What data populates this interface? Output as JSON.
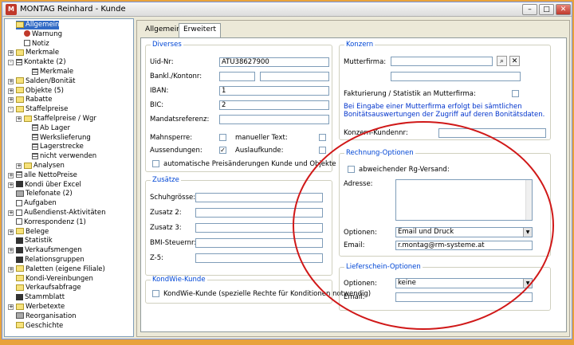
{
  "window": {
    "title": "MONTAG Reinhard - Kunde",
    "app_icon_text": "M",
    "btn_min": "–",
    "btn_max": "□",
    "btn_close": "✕"
  },
  "tree": [
    {
      "label": "Allgemein",
      "icon": "folder",
      "level": 0,
      "exp": "",
      "selected": true
    },
    {
      "label": "Warnung",
      "icon": "red",
      "level": 1,
      "exp": ""
    },
    {
      "label": "Notiz",
      "icon": "doc",
      "level": 1,
      "exp": ""
    },
    {
      "label": "Merkmale",
      "icon": "folder",
      "level": 0,
      "exp": "+"
    },
    {
      "label": "Kontakte (2)",
      "icon": "list",
      "level": 0,
      "exp": "-"
    },
    {
      "label": "Merkmale",
      "icon": "list",
      "level": 2,
      "exp": ""
    },
    {
      "label": "Salden/Bonität",
      "icon": "folder",
      "level": 0,
      "exp": "+"
    },
    {
      "label": "Objekte (5)",
      "icon": "folder",
      "level": 0,
      "exp": "+"
    },
    {
      "label": "Rabatte",
      "icon": "folder",
      "level": 0,
      "exp": "+"
    },
    {
      "label": "Staffelpreise",
      "icon": "folder",
      "level": 0,
      "exp": "-"
    },
    {
      "label": "Staffelpreise / Wgr",
      "icon": "folder",
      "level": 1,
      "exp": "+"
    },
    {
      "label": "Ab Lager",
      "icon": "list",
      "level": 2,
      "exp": ""
    },
    {
      "label": "Werkslieferung",
      "icon": "list",
      "level": 2,
      "exp": ""
    },
    {
      "label": "Lagerstrecke",
      "icon": "list",
      "level": 2,
      "exp": ""
    },
    {
      "label": "nicht verwenden",
      "icon": "list",
      "level": 2,
      "exp": ""
    },
    {
      "label": "Analysen",
      "icon": "folder",
      "level": 1,
      "exp": "+"
    },
    {
      "label": "alle NettoPreise",
      "icon": "list",
      "level": 0,
      "exp": "+"
    },
    {
      "label": "Kondi über Excel",
      "icon": "blk",
      "level": 0,
      "exp": "+"
    },
    {
      "label": "Telefonate (2)",
      "icon": "gray",
      "level": 0,
      "exp": ""
    },
    {
      "label": "Aufgaben",
      "icon": "doc",
      "level": 0,
      "exp": ""
    },
    {
      "label": "Außendienst-Aktivitäten",
      "icon": "doc",
      "level": 0,
      "exp": "+"
    },
    {
      "label": "Korrespondenz (1)",
      "icon": "doc",
      "level": 0,
      "exp": ""
    },
    {
      "label": "Belege",
      "icon": "folder",
      "level": 0,
      "exp": "+"
    },
    {
      "label": "Statistik",
      "icon": "blk",
      "level": 0,
      "exp": ""
    },
    {
      "label": "Verkaufsmengen",
      "icon": "blk",
      "level": 0,
      "exp": "+"
    },
    {
      "label": "Relationsgruppen",
      "icon": "blk",
      "level": 0,
      "exp": ""
    },
    {
      "label": "Paletten (eigene Filiale)",
      "icon": "folder",
      "level": 0,
      "exp": "+"
    },
    {
      "label": "Kondi-Vereinbungen",
      "icon": "folder",
      "level": 0,
      "exp": ""
    },
    {
      "label": "Verkaufsabfrage",
      "icon": "folder",
      "level": 0,
      "exp": ""
    },
    {
      "label": "Stammblatt",
      "icon": "blk",
      "level": 0,
      "exp": ""
    },
    {
      "label": "Werbetexte",
      "icon": "folder",
      "level": 0,
      "exp": "+"
    },
    {
      "label": "Reorganisation",
      "icon": "gray",
      "level": 0,
      "exp": ""
    },
    {
      "label": "Geschichte",
      "icon": "folder",
      "level": 0,
      "exp": ""
    }
  ],
  "tabs": {
    "allgemein": "Allgemein",
    "erweitert": "Erweitert"
  },
  "diverses": {
    "title": "Diverses",
    "uid_label": "Uid-Nr:",
    "uid_value": "ATU38627900",
    "bank_label": "Bankl./Kontonr:",
    "iban_label": "IBAN:",
    "iban_value": "1",
    "bic_label": "BIC:",
    "bic_value": "2",
    "mandat_label": "Mandatsreferenz:",
    "mahnsperre_label": "Mahnsperre:",
    "manuell_label": "manueller Text:",
    "aussendungen_label": "Aussendungen:",
    "aussendungen_check": "✓",
    "auslauf_label": "Auslaufkunde:",
    "auto_label": "automatische Preisänderungen Kunde und Objekte"
  },
  "zusaetze": {
    "title": "Zusätze",
    "schuh_label": "Schuhgrösse:",
    "z2_label": "Zusatz 2:",
    "z3_label": "Zusatz 3:",
    "bmi_label": "BMI-Steuernr:",
    "z5_label": "Z-5:"
  },
  "kondwie": {
    "title": "KondWie-Kunde",
    "label": "KondWie-Kunde (spezielle Rechte für Konditionen notwendig)"
  },
  "konzern": {
    "title": "Konzern",
    "mutter_label": "Mutterfirma:",
    "fakt_label": "Fakturierung / Statistik an Mutterfirma:",
    "note": "Bei Eingabe einer Mutterfirma erfolgt bei sämtlichen Bonitätsauswertungen der Zugriff auf deren Bonitätsdaten.",
    "konzern_label": "Konzern-Kundennr:",
    "search_glyph": "⌕",
    "clear_glyph": "✕"
  },
  "rechnung": {
    "title": "Rechnung-Optionen",
    "abw_label": "abweichender Rg-Versand:",
    "adresse_label": "Adresse:",
    "optionen_label": "Optionen:",
    "optionen_value": "Email und Druck",
    "email_label": "Email:",
    "email_value": "r.montag@rm-systeme.at"
  },
  "liefer": {
    "title": "Lieferschein-Optionen",
    "optionen_label": "Optionen:",
    "optionen_value": "keine",
    "email_label": "Email:"
  },
  "colors": {
    "highlight": "#316ac5",
    "ellipse": "#d01818",
    "group_title": "#0046d5"
  }
}
